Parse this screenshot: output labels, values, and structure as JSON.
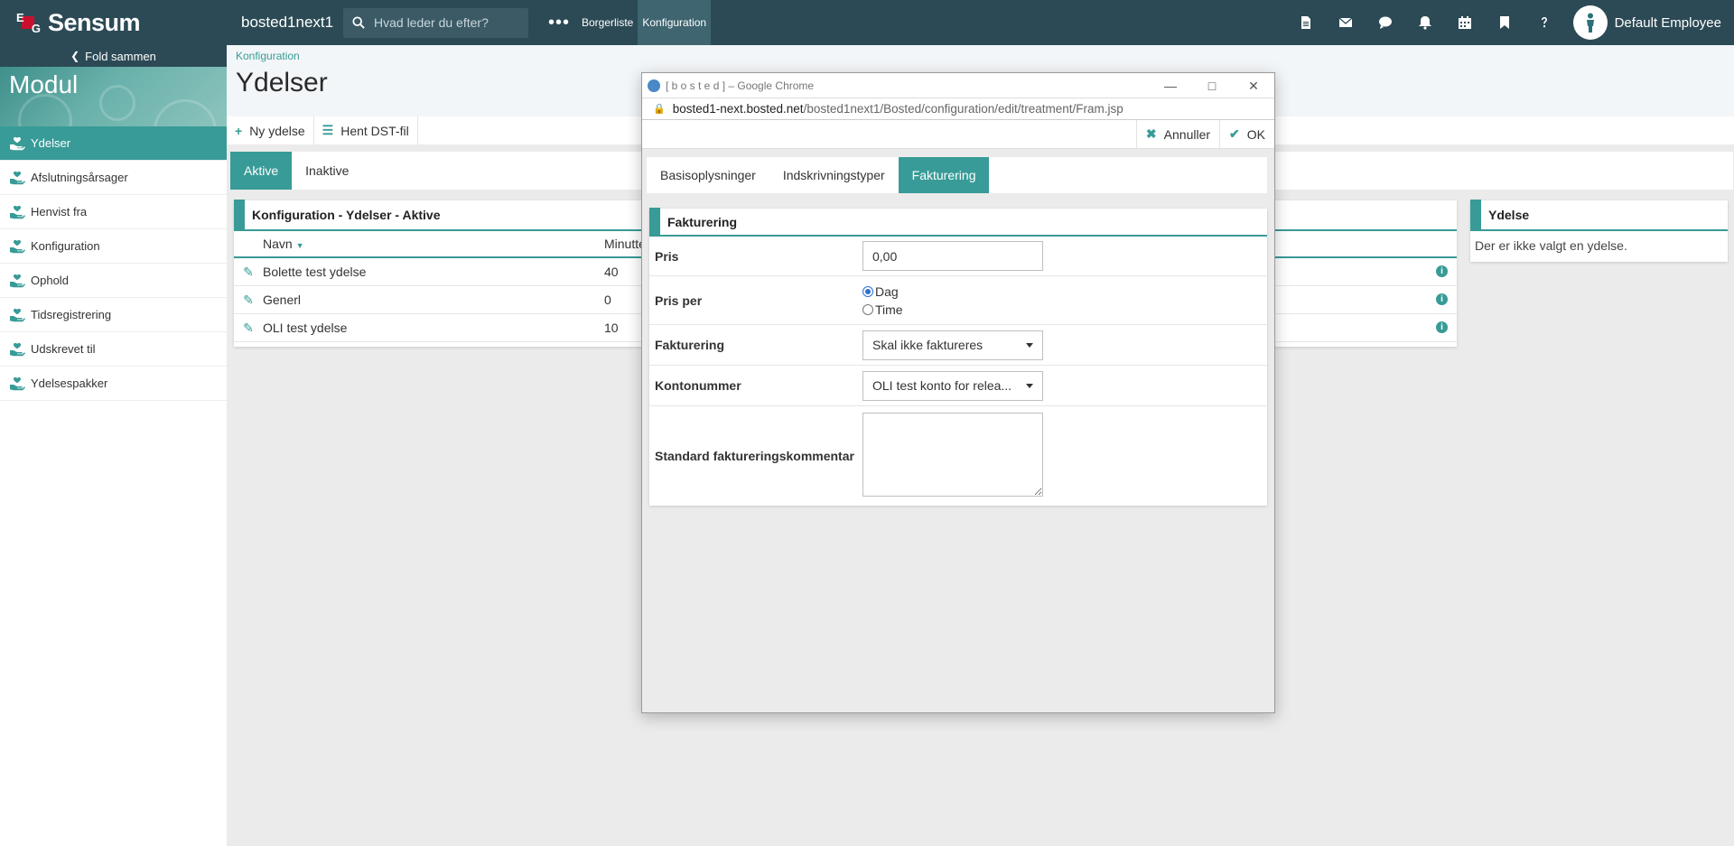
{
  "topbar": {
    "brand": "Sensum",
    "logo_letters": [
      "E",
      "G"
    ],
    "instance": "bosted1next1",
    "search_placeholder": "Hvad leder du efter?",
    "more_icon": "ellipsis-icon",
    "nav": [
      {
        "label": "Borgerliste",
        "active": false
      },
      {
        "label": "Konfiguration",
        "active": true
      }
    ],
    "icons": [
      "document-icon",
      "envelope-icon",
      "chat-icon",
      "bell-icon",
      "calendar-icon",
      "bookmark-icon",
      "help-icon"
    ],
    "user_name": "Default Employee"
  },
  "sidebar": {
    "fold_label": "Fold sammen",
    "module_title": "Modul",
    "items": [
      {
        "label": "Ydelser",
        "active": true
      },
      {
        "label": "Afslutningsårsager",
        "active": false
      },
      {
        "label": "Henvist fra",
        "active": false
      },
      {
        "label": "Konfiguration",
        "active": false
      },
      {
        "label": "Ophold",
        "active": false
      },
      {
        "label": "Tidsregistrering",
        "active": false
      },
      {
        "label": "Udskrevet til",
        "active": false
      },
      {
        "label": "Ydelsespakker",
        "active": false
      }
    ]
  },
  "main": {
    "breadcrumb": "Konfiguration",
    "title": "Ydelser",
    "toolbar": {
      "new_label": "Ny ydelse",
      "dst_label": "Hent DST-fil"
    },
    "tabs": [
      {
        "label": "Aktive",
        "active": true
      },
      {
        "label": "Inaktive",
        "active": false
      }
    ],
    "panel_title": "Konfiguration - Ydelser - Aktive",
    "columns": {
      "name": "Navn",
      "minutes": "Minutter"
    },
    "rows": [
      {
        "name": "Bolette test ydelse",
        "minutes": "40"
      },
      {
        "name": "Generl",
        "minutes": "0"
      },
      {
        "name": "OLI test ydelse",
        "minutes": "10"
      }
    ],
    "right_panel": {
      "title": "Ydelse",
      "body": "Der er ikke valgt en ydelse."
    }
  },
  "dialog": {
    "window_title": "[ b o s t e d ] – Google Chrome",
    "url_host": "bosted1-next.bosted.net",
    "url_path": "/bosted1next1/Bosted/configuration/edit/treatment/Fram.jsp",
    "cancel_label": "Annuller",
    "ok_label": "OK",
    "tabs": [
      {
        "label": "Basisoplysninger",
        "active": false
      },
      {
        "label": "Indskrivningstyper",
        "active": false
      },
      {
        "label": "Fakturering",
        "active": true
      }
    ],
    "form_title": "Fakturering",
    "fields": {
      "price_label": "Pris",
      "price_value": "0,00",
      "price_per_label": "Pris per",
      "price_per_options": [
        {
          "label": "Dag",
          "checked": true
        },
        {
          "label": "Time",
          "checked": false
        }
      ],
      "billing_label": "Fakturering",
      "billing_value": "Skal ikke faktureres",
      "account_label": "Kontonummer",
      "account_value": "OLI test konto for relea...",
      "comment_label": "Standard faktureringskommentar",
      "comment_value": ""
    }
  }
}
